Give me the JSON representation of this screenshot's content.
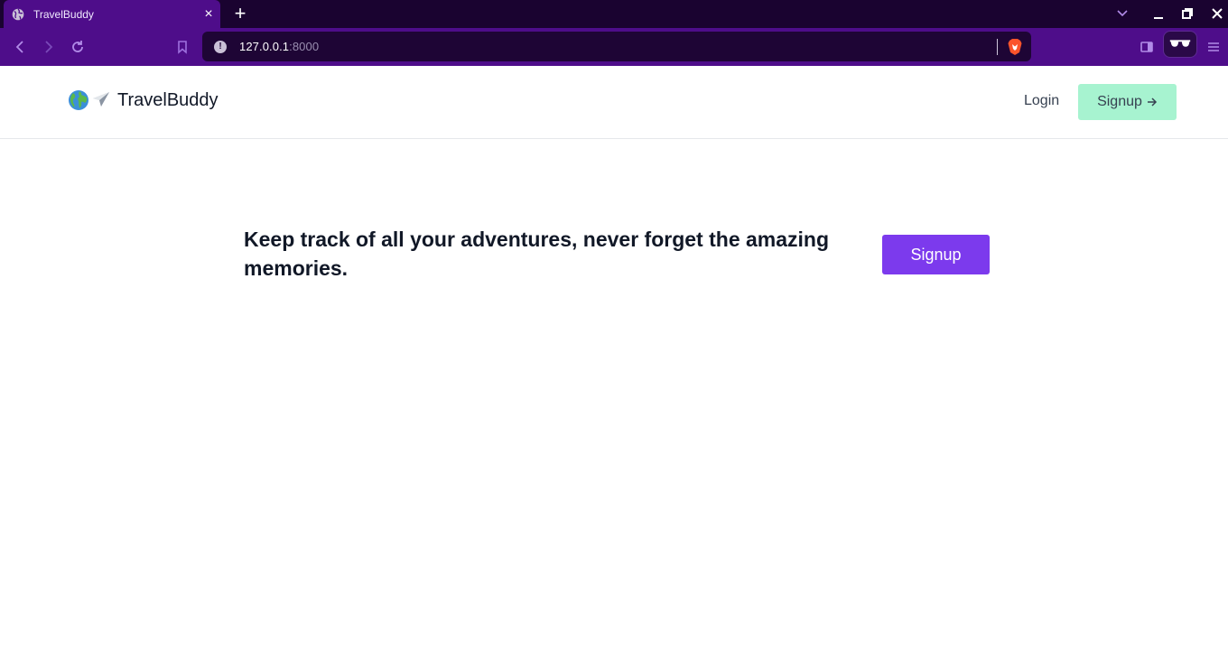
{
  "browser": {
    "tab_title": "TravelBuddy",
    "tab_close": "×",
    "new_tab": "+",
    "url_host": "127.0.0.1",
    "url_port": ":8000",
    "info_glyph": "!",
    "colors": {
      "tabbar": "#1a0330",
      "toolbar": "#4e0d8a",
      "omnibox": "#1e0535"
    }
  },
  "site": {
    "brand_name": "TravelBuddy",
    "brand_icons": [
      "globe-icon",
      "airplane-icon"
    ],
    "nav": {
      "login": "Login",
      "signup": "Signup"
    }
  },
  "hero": {
    "headline": "Keep track of all your adventures, never forget the amazing memories.",
    "signup": "Signup"
  },
  "colors": {
    "primary": "#7c3aed",
    "nav_signup_bg": "#a7f3d0",
    "text_dark": "#111827",
    "text_muted": "#374151"
  }
}
